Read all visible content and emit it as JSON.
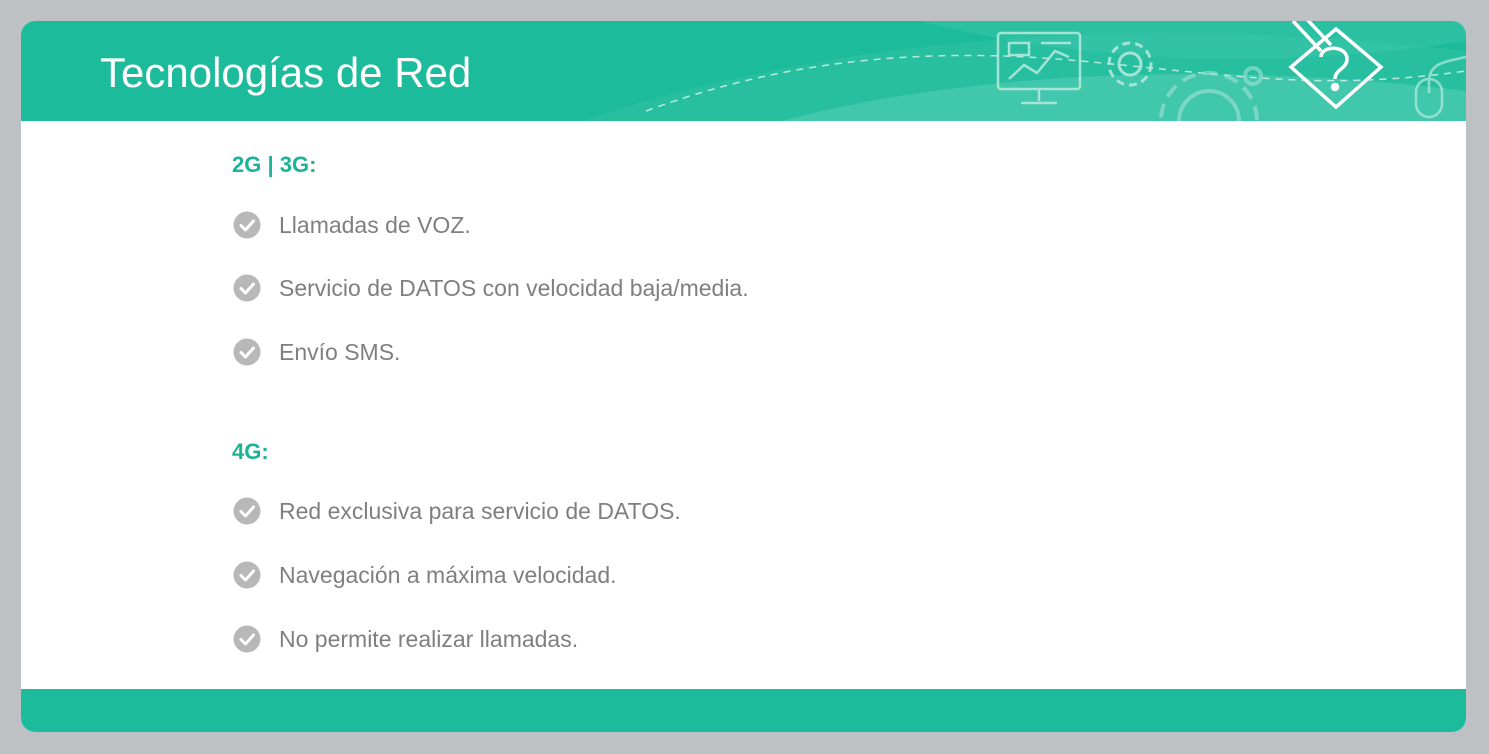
{
  "slide": {
    "title": "Tecnologías de Red",
    "accent_color": "#1cbb9b",
    "heading_color": "#1cb496",
    "text_color": "#7f7f7f",
    "icon_color": "#b8b8b8",
    "header_icons": [
      "monitor-chart-icon",
      "gear-icon",
      "cogwheel-icon",
      "pencil-question-icon",
      "mouse-icon"
    ]
  },
  "sections": [
    {
      "heading": "2G | 3G:",
      "items": [
        {
          "icon": "check-circle-icon",
          "text": "Llamadas de VOZ."
        },
        {
          "icon": "check-circle-icon",
          "text": "Servicio de DATOS con velocidad baja/media."
        },
        {
          "icon": "check-circle-icon",
          "text": "Envío SMS."
        }
      ]
    },
    {
      "heading": "4G:",
      "items": [
        {
          "icon": "check-circle-icon",
          "text": "Red exclusiva para servicio de DATOS."
        },
        {
          "icon": "check-circle-icon",
          "text": "Navegación a máxima velocidad."
        },
        {
          "icon": "check-circle-icon",
          "text": "No permite realizar llamadas."
        }
      ]
    }
  ]
}
